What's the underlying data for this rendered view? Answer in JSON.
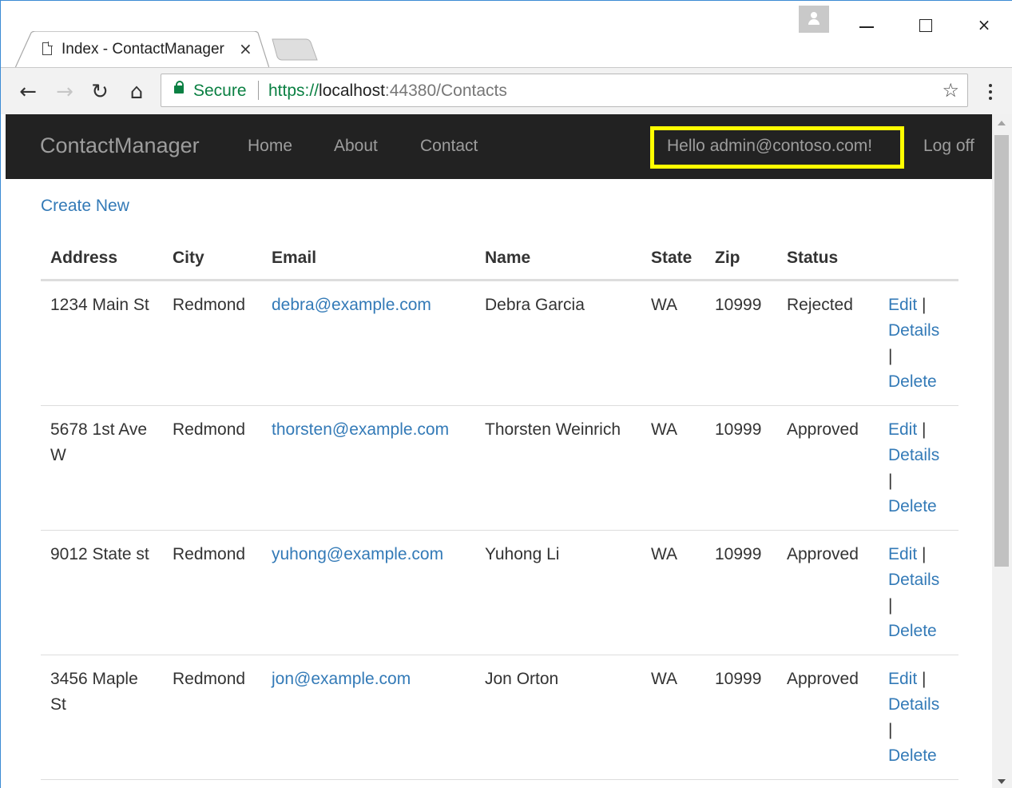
{
  "browser": {
    "tab_title": "Index - ContactManager",
    "tab_close": "×",
    "window_close": "×",
    "secure_label": "Secure",
    "url_scheme": "https://",
    "url_host": "localhost",
    "url_rest": ":44380/Contacts",
    "icons": [
      "back-arrow-icon",
      "forward-arrow-icon",
      "reload-icon",
      "home-icon",
      "lock-icon",
      "star-icon",
      "menu-dots-icon",
      "profile-icon",
      "minimize-icon",
      "maximize-icon",
      "close-icon"
    ],
    "back_glyph": "←",
    "forward_glyph": "→",
    "reload_glyph": "↻",
    "home_glyph": "⌂",
    "star_glyph": "☆"
  },
  "navbar": {
    "brand": "ContactManager",
    "links": [
      "Home",
      "About",
      "Contact"
    ],
    "hello": "Hello admin@contoso.com!",
    "logoff": "Log off",
    "highlight_color": "#ffff00"
  },
  "page": {
    "create_new": "Create New",
    "columns": [
      "Address",
      "City",
      "Email",
      "Name",
      "State",
      "Zip",
      "Status"
    ],
    "actions": {
      "edit": "Edit",
      "details": "Details",
      "delete": "Delete",
      "separator": "|"
    },
    "rows": [
      {
        "address": "1234 Main St",
        "city": "Redmond",
        "email": "debra@example.com",
        "name": "Debra Garcia",
        "state": "WA",
        "zip": "10999",
        "status": "Rejected"
      },
      {
        "address": "5678 1st Ave W",
        "city": "Redmond",
        "email": "thorsten@example.com",
        "name": "Thorsten Weinrich",
        "state": "WA",
        "zip": "10999",
        "status": "Approved"
      },
      {
        "address": "9012 State st",
        "city": "Redmond",
        "email": "yuhong@example.com",
        "name": "Yuhong Li",
        "state": "WA",
        "zip": "10999",
        "status": "Approved"
      },
      {
        "address": "3456 Maple St",
        "city": "Redmond",
        "email": "jon@example.com",
        "name": "Jon Orton",
        "state": "WA",
        "zip": "10999",
        "status": "Approved"
      }
    ]
  },
  "colors": {
    "link": "#337ab7",
    "navbar_bg": "#222222",
    "navbar_text": "#9d9d9d",
    "secure_green": "#0b8043"
  }
}
